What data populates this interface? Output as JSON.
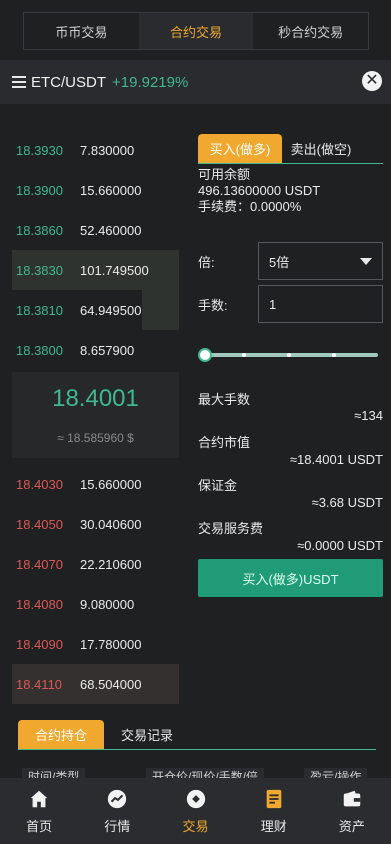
{
  "top_tabs": [
    {
      "label": "币币交易"
    },
    {
      "label": "合约交易"
    },
    {
      "label": "秒合约交易"
    }
  ],
  "pair": {
    "name": "ETC/USDT",
    "change": "+19.9219%"
  },
  "orderbook": {
    "bids": [
      {
        "price": "18.3930",
        "qty": "7.830000",
        "depth": 0
      },
      {
        "price": "18.3900",
        "qty": "15.660000",
        "depth": 0
      },
      {
        "price": "18.3860",
        "qty": "52.460000",
        "depth": 0
      },
      {
        "price": "18.3830",
        "qty": "101.749500",
        "depth": 1.0
      },
      {
        "price": "18.3810",
        "qty": "64.949500",
        "depth": 0.22
      },
      {
        "price": "18.3800",
        "qty": "8.657900",
        "depth": 0
      }
    ],
    "mid_price": "18.4001",
    "mid_value": "≈ 18.585960 $",
    "asks": [
      {
        "price": "18.4030",
        "qty": "15.660000",
        "depth": 0
      },
      {
        "price": "18.4050",
        "qty": "30.040600",
        "depth": 0
      },
      {
        "price": "18.4070",
        "qty": "22.210600",
        "depth": 0
      },
      {
        "price": "18.4080",
        "qty": "9.080000",
        "depth": 0
      },
      {
        "price": "18.4090",
        "qty": "17.780000",
        "depth": 0
      },
      {
        "price": "18.4110",
        "qty": "68.504000",
        "depth": 1.0
      }
    ]
  },
  "trade": {
    "buy_tab": "买入(做多)",
    "sell_tab": "卖出(做空)",
    "balance_label": "可用余额",
    "balance_value": "496.13600000 USDT",
    "fee_text": "手续费：0.0000%",
    "leverage_label": "倍:",
    "leverage_value": "5倍",
    "lots_label": "手数:",
    "lots_value": "1",
    "slider_value": 0,
    "max_lots_label": "最大手数",
    "max_lots_value": "≈134",
    "market_value_label": "合约市值",
    "market_value_value": "≈18.4001 USDT",
    "margin_label": "保证金",
    "margin_value": "≈3.68 USDT",
    "service_fee_label": "交易服务费",
    "service_fee_value": "≈0.0000 USDT",
    "submit_label": "买入(做多)USDT"
  },
  "positions": {
    "tabs": [
      {
        "label": "合约持仓"
      },
      {
        "label": "交易记录"
      }
    ],
    "headers": [
      "时间/类型",
      "开仓价/现价/手数/倍",
      "盈亏/操作"
    ]
  },
  "nav": [
    {
      "label": "首页",
      "icon": "home-icon"
    },
    {
      "label": "行情",
      "icon": "chart-icon"
    },
    {
      "label": "交易",
      "icon": "trade-icon"
    },
    {
      "label": "理财",
      "icon": "finance-icon"
    },
    {
      "label": "资产",
      "icon": "wallet-icon"
    }
  ],
  "colors": {
    "accent": "#f0a92e",
    "up": "#3fb98e",
    "down": "#e05656",
    "button": "#1f9b78"
  }
}
